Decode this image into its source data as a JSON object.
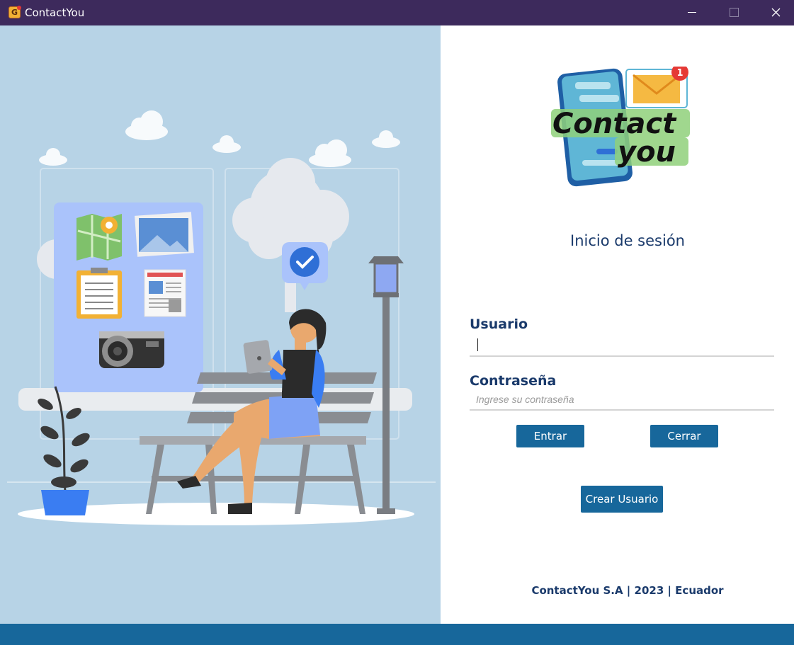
{
  "window": {
    "title": "ContactYou",
    "icon": "contactyou-app-icon",
    "controls": [
      "minimize-icon",
      "maximize-icon",
      "close-icon"
    ]
  },
  "logo": {
    "line1": "Contact",
    "line2": "you",
    "badge_count": "1"
  },
  "login": {
    "title": "Inicio de sesión",
    "user_label": "Usuario",
    "user_value": "",
    "password_label": "Contraseña",
    "password_placeholder": "Ingrese su contraseña",
    "enter_button": "Entrar",
    "close_button": "Cerrar",
    "create_button": "Crear Usuario"
  },
  "footer": {
    "text": "ContactYou S.A  |  2023  |  Ecuador"
  },
  "colors": {
    "titlebar": "#3d2a5c",
    "accent": "#17679b",
    "heading": "#1a3a6b",
    "illustration_bg": "#b7d3e6"
  }
}
